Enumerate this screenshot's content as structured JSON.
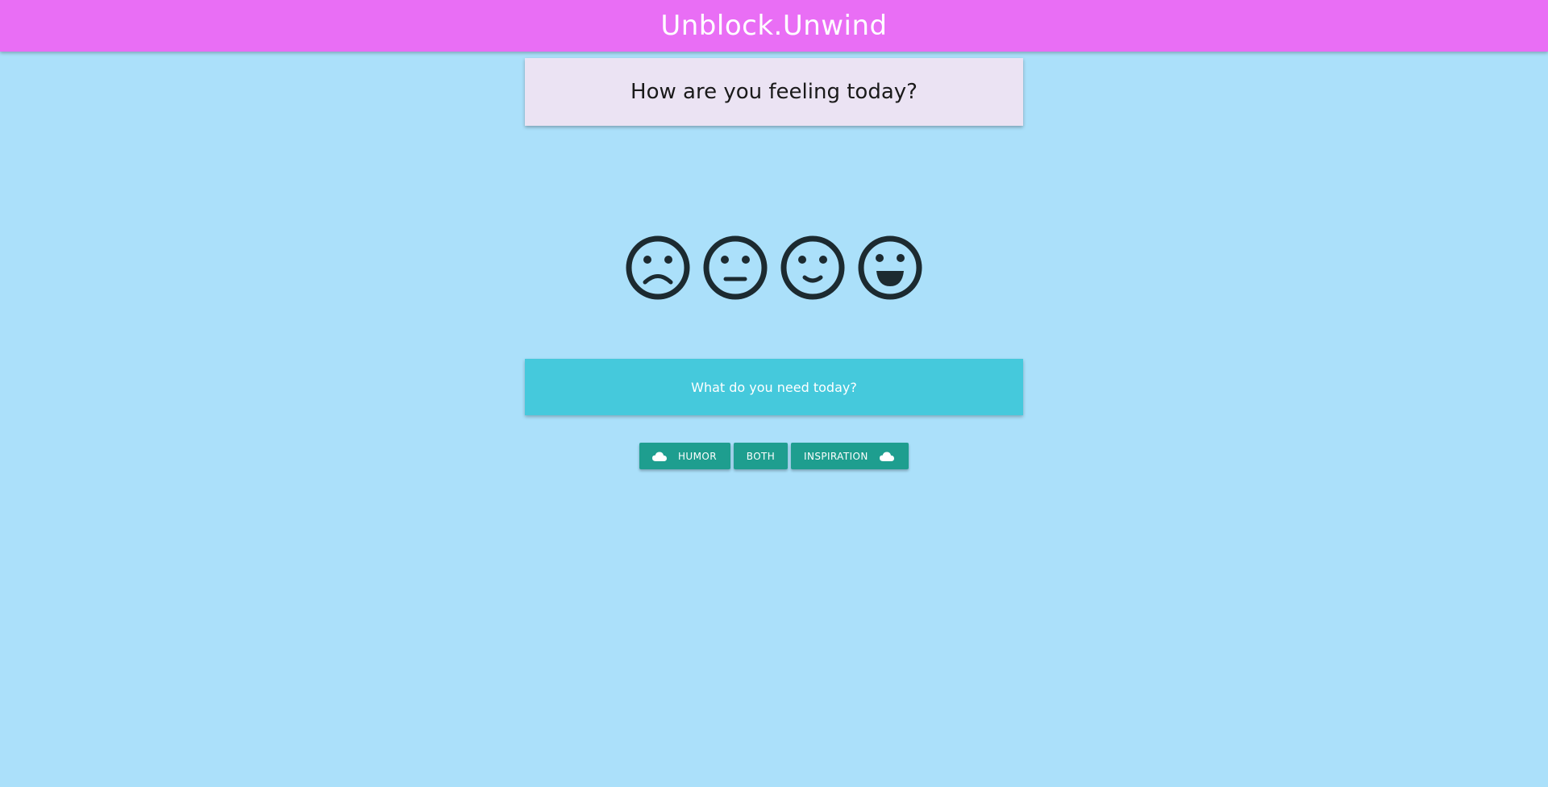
{
  "app": {
    "title": "Unblock.Unwind"
  },
  "colors": {
    "background": "#abe0fa",
    "topbar": "#e96ef5",
    "question_card": "#ebe3f3",
    "need_card": "#45c9dc",
    "button": "#1e9e8f",
    "icon": "#1c2a30"
  },
  "feeling": {
    "question": "How are you feeling today?",
    "moods": [
      {
        "icon": "sad-face-icon"
      },
      {
        "icon": "neutral-face-icon"
      },
      {
        "icon": "slight-smile-face-icon"
      },
      {
        "icon": "grin-face-icon"
      }
    ]
  },
  "need": {
    "question": "What do you need today?",
    "buttons": {
      "humor": {
        "label": "HUMOR",
        "icon": "cloud-icon"
      },
      "both": {
        "label": "BOTH"
      },
      "inspiration": {
        "label": "INSPIRATION",
        "icon": "cloud-icon"
      }
    }
  }
}
